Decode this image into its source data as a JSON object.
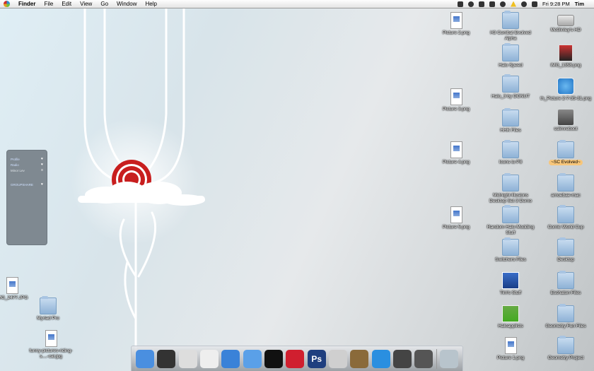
{
  "menubar": {
    "app_name": "Finder",
    "items": [
      "File",
      "Edit",
      "View",
      "Go",
      "Window",
      "Help"
    ],
    "clock": "Fri 9:28 PM",
    "user": "Tim"
  },
  "widget": {
    "rows": [
      {
        "label": "Profile"
      },
      {
        "label": "Radio"
      },
      {
        "label": "Minor Lev"
      },
      {
        "label": "GROUPSHARE"
      }
    ]
  },
  "desktop_icons": [
    {
      "label": "Picture 2.png",
      "type": "file"
    },
    {
      "label": "H3 Combat Evolved Alpha",
      "type": "folder"
    },
    {
      "label": "McGinley's HD",
      "type": "disk"
    },
    {
      "label": "Halo Speed",
      "type": "folder"
    },
    {
      "label": "IMG_1358.png",
      "type": "pic"
    },
    {
      "label": "Picture 3.png",
      "type": "file"
    },
    {
      "label": "Halo_3 by DONUT",
      "type": "folder"
    },
    {
      "label": "th_Picture 2-7-35-31.png",
      "type": "bluepic"
    },
    {
      "label": "HHK Files",
      "type": "folder"
    },
    {
      "label": "sslimreboot",
      "type": "app"
    },
    {
      "label": "Picture 4.png",
      "type": "file"
    },
    {
      "label": "Icons to P8",
      "type": "folder"
    },
    {
      "label": "~SC Evolved~",
      "type": "folder"
    },
    {
      "label": "Midnight Illusions Desktop Set 3 Demo",
      "type": "folder"
    },
    {
      "label": "amoebae-mac",
      "type": "folder"
    },
    {
      "label": "Picture 5.png",
      "type": "file"
    },
    {
      "label": "Random Halo Modding Stuff",
      "type": "folder"
    },
    {
      "label": "Comic World Cup",
      "type": "folder"
    },
    {
      "label": "Switchers Files",
      "type": "folder"
    },
    {
      "label": "Desktop",
      "type": "folder"
    },
    {
      "label": "Tim's Stuff",
      "type": "blueapp"
    },
    {
      "label": "Eschaton Files",
      "type": "folder"
    },
    {
      "label": "Haloapplists",
      "type": "green"
    },
    {
      "label": "Geometry Fun Files",
      "type": "folder"
    },
    {
      "label": "Picture 1.png",
      "type": "file"
    },
    {
      "label": "Geometry Project",
      "type": "folder"
    },
    {
      "label": "IMG_2477.JPG",
      "type": "file"
    },
    {
      "label": "Myriad Pro",
      "type": "folder"
    },
    {
      "label": "funny-pictures-riding-s....-cat.jpg",
      "type": "file"
    }
  ],
  "dock": {
    "items": [
      {
        "name": "finder-icon",
        "color": "#4a8fe0",
        "glyph": ""
      },
      {
        "name": "dashboard-icon",
        "color": "#333333",
        "glyph": ""
      },
      {
        "name": "mail-icon",
        "color": "#dddddd",
        "glyph": ""
      },
      {
        "name": "textedit-icon",
        "color": "#eeeeee",
        "glyph": ""
      },
      {
        "name": "safari-icon",
        "color": "#3a82d8",
        "glyph": ""
      },
      {
        "name": "adium-icon",
        "color": "#5aa0e8",
        "glyph": ""
      },
      {
        "name": "speaker-icon",
        "color": "#111111",
        "glyph": ""
      },
      {
        "name": "lastfm-icon",
        "color": "#d01f2f",
        "glyph": ""
      },
      {
        "name": "photoshop-icon",
        "color": "#1f3f7f",
        "glyph": "Ps"
      },
      {
        "name": "ichat-icon",
        "color": "#cfcfcf",
        "glyph": ""
      },
      {
        "name": "iphoto-icon",
        "color": "#8a6a3a",
        "glyph": ""
      },
      {
        "name": "skype-icon",
        "color": "#2a8fe0",
        "glyph": ""
      },
      {
        "name": "adium-duck-icon",
        "color": "#444444",
        "glyph": ""
      },
      {
        "name": "dvd-icon",
        "color": "#555555",
        "glyph": ""
      },
      {
        "name": "trash-icon",
        "color": "#b8c4cc",
        "glyph": ""
      }
    ]
  }
}
